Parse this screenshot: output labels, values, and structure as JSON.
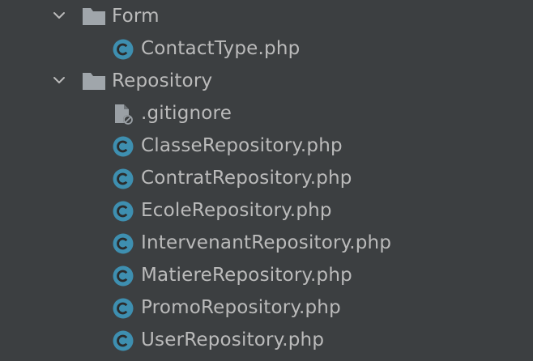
{
  "colors": {
    "background": "#3c3f41",
    "text": "#bbbbbb",
    "folder": "#a0a6ab",
    "php_class_icon": "#3e8fb0",
    "ignore_file_icon": "#9aa0a5"
  },
  "tree": {
    "form_folder": {
      "label": "Form",
      "expanded": true,
      "icon": "folder-icon",
      "files": [
        {
          "label": "ContactType.php",
          "icon": "php-class-icon"
        }
      ]
    },
    "repository_folder": {
      "label": "Repository",
      "expanded": true,
      "icon": "folder-icon",
      "files": [
        {
          "label": ".gitignore",
          "icon": "ignore-file-icon"
        },
        {
          "label": "ClasseRepository.php",
          "icon": "php-class-icon"
        },
        {
          "label": "ContratRepository.php",
          "icon": "php-class-icon"
        },
        {
          "label": "EcoleRepository.php",
          "icon": "php-class-icon"
        },
        {
          "label": "IntervenantRepository.php",
          "icon": "php-class-icon"
        },
        {
          "label": "MatiereRepository.php",
          "icon": "php-class-icon"
        },
        {
          "label": "PromoRepository.php",
          "icon": "php-class-icon"
        },
        {
          "label": "UserRepository.php",
          "icon": "php-class-icon"
        }
      ]
    }
  }
}
